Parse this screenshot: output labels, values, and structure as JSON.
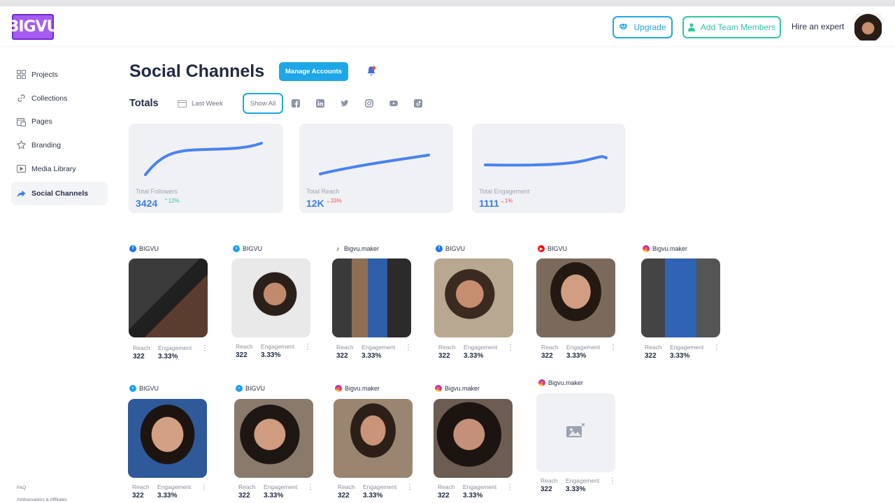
{
  "header": {
    "logo_text": "BIGVU",
    "upgrade_label": "Upgrade",
    "add_team_label": "Add Team Members",
    "hire_label": "Hire an expert"
  },
  "sidebar": {
    "items": [
      {
        "label": "Projects",
        "icon": "grid-icon"
      },
      {
        "label": "Collections",
        "icon": "link-icon"
      },
      {
        "label": "Pages",
        "icon": "pages-icon"
      },
      {
        "label": "Branding",
        "icon": "star-icon"
      },
      {
        "label": "Media Library",
        "icon": "media-icon"
      },
      {
        "label": "Social Channels",
        "icon": "share-icon",
        "active": true
      }
    ],
    "footer": {
      "faq": "FAQ",
      "ambassadors": "Ambassadors & Affiliates"
    }
  },
  "main": {
    "title": "Social Channels",
    "manage_label": "Manage Accounts",
    "totals_label": "Totals",
    "period_label": "Last Week",
    "show_all_label": "Show All",
    "filters": [
      "facebook-icon",
      "linkedin-icon",
      "twitter-icon",
      "instagram-icon",
      "youtube-icon",
      "tiktok-icon"
    ]
  },
  "stats": [
    {
      "label": "Total Followers",
      "value": "3424",
      "change": "12%",
      "direction": "up"
    },
    {
      "label": "Total Reach",
      "value": "12K",
      "change": "33%",
      "direction": "down"
    },
    {
      "label": "Total Engagement",
      "value": "1111",
      "change": "1%",
      "direction": "down"
    }
  ],
  "posts_labels": {
    "reach": "Reach",
    "engagement": "Engagement"
  },
  "posts": [
    {
      "network": "facebook",
      "account": "BIGVU",
      "reach": "322",
      "engagement": "3.33%"
    },
    {
      "network": "twitter",
      "account": "BIGVU",
      "reach": "322",
      "engagement": "3.33%"
    },
    {
      "network": "tiktok",
      "account": "Bigvu.maker",
      "reach": "322",
      "engagement": "3.33%"
    },
    {
      "network": "facebook",
      "account": "BIGVU",
      "reach": "322",
      "engagement": "3.33%"
    },
    {
      "network": "youtube",
      "account": "BIGVU",
      "reach": "322",
      "engagement": "3.33%"
    },
    {
      "network": "instagram",
      "account": "Bigvu.maker",
      "reach": "322",
      "engagement": "3.33%"
    },
    {
      "network": "twitter",
      "account": "BIGVU",
      "reach": "322",
      "engagement": "3.33%"
    },
    {
      "network": "twitter",
      "account": "BIGVU",
      "reach": "322",
      "engagement": "3.33%"
    },
    {
      "network": "instagram",
      "account": "Bigvu.maker",
      "reach": "322",
      "engagement": "3.33%"
    },
    {
      "network": "instagram",
      "account": "Bigvu.maker",
      "reach": "322",
      "engagement": "3.33%"
    },
    {
      "network": "instagram",
      "account": "Bigvu.maker",
      "reach": "322",
      "engagement": "3.33%",
      "placeholder": true
    }
  ],
  "colors": {
    "accent": "#1ea7e8",
    "team": "#2ec7a5",
    "chart_line": "#3b7ee8",
    "up": "#2ec7a5",
    "down": "#e85a5a"
  }
}
